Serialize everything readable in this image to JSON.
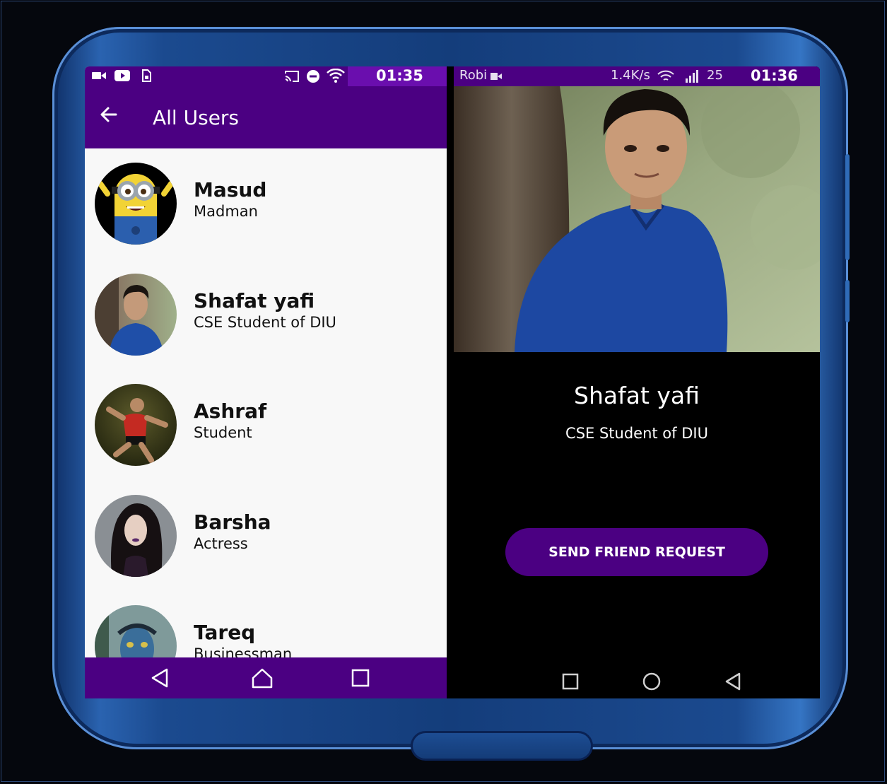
{
  "left_screen": {
    "status_bar": {
      "time": "01:35",
      "icons": [
        "video-call-icon",
        "youtube-icon",
        "sim-icon",
        "cast-icon",
        "dnd-icon",
        "wifi-icon"
      ]
    },
    "app_bar": {
      "title": "All Users",
      "back_icon": "arrow-left-icon"
    },
    "users": [
      {
        "name": "Masud",
        "status": "Madman",
        "avatar": "minion-avatar"
      },
      {
        "name": "Shafat yafi",
        "status": "CSE Student of DIU",
        "avatar": "man-blue-shirt-avatar"
      },
      {
        "name": "Ashraf",
        "status": "Student",
        "avatar": "soccer-player-avatar"
      },
      {
        "name": "Barsha",
        "status": "Actress",
        "avatar": "woman-portrait-avatar"
      },
      {
        "name": "Tareq",
        "status": "Businessman",
        "avatar": "avatar-blue-alien-avatar"
      }
    ],
    "nav_bar": [
      "back-triangle-icon",
      "home-icon",
      "recents-square-icon"
    ]
  },
  "right_screen": {
    "status_bar": {
      "carrier": "Robi",
      "speed": "1.4K/s",
      "battery": "25",
      "time": "01:36"
    },
    "profile": {
      "name": "Shafat yafi",
      "status": "CSE Student of DIU"
    },
    "action_button": "SEND FRIEND REQUEST",
    "nav_bar": [
      "recents-square-icon",
      "home-circle-icon",
      "back-triangle-icon"
    ]
  },
  "colors": {
    "primary": "#4b0082",
    "status_accent": "#6a0eae",
    "list_bg": "#f8f8f8",
    "profile_bg": "#000000",
    "phone_body": "#1b4a8f"
  }
}
